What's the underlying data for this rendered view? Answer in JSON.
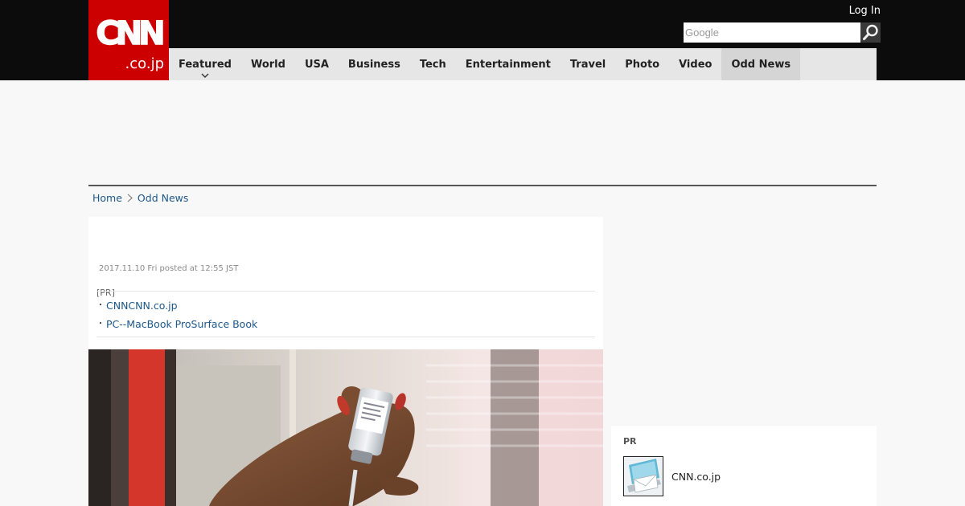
{
  "header": {
    "logo_main": "CNN",
    "logo_sub": ".co.jp",
    "login_label": "Log In",
    "search_placeholder": "Google"
  },
  "nav": {
    "items": [
      {
        "label": "Featured"
      },
      {
        "label": "World"
      },
      {
        "label": "USA"
      },
      {
        "label": "Business"
      },
      {
        "label": "Tech"
      },
      {
        "label": "Entertainment"
      },
      {
        "label": "Travel"
      },
      {
        "label": "Photo"
      },
      {
        "label": "Video"
      },
      {
        "label": "Odd News"
      }
    ],
    "active": "Odd News"
  },
  "breadcrumb": {
    "home": "Home",
    "current": "Odd News"
  },
  "article": {
    "timestamp": "2017.11.10 Fri posted at 12:55 JST",
    "pr_label": "[PR]",
    "pr_links": [
      {
        "bullet": "・",
        "text": "CNNCNN.co.jp"
      },
      {
        "bullet": "・",
        "text": "PC--MacBook ProSurface Book"
      }
    ]
  },
  "sidebar": {
    "pr_title": "PR",
    "item_text": "CNN.co.jp"
  },
  "colors": {
    "brand_red": "#cc0000",
    "header_black": "#0c0c0c",
    "nav_gray": "#e6e6e6",
    "link_blue": "#1d5889"
  }
}
